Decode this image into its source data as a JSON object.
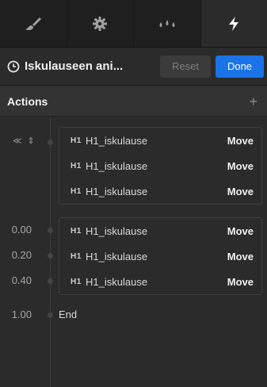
{
  "tabs": [
    {
      "icon": "brush-icon"
    },
    {
      "icon": "gear-icon"
    },
    {
      "icon": "droplets-icon"
    },
    {
      "icon": "lightning-icon",
      "active": true
    }
  ],
  "header": {
    "title": "Iskulauseen ani...",
    "reset_label": "Reset",
    "done_label": "Done"
  },
  "actions": {
    "title": "Actions",
    "add_label": "+"
  },
  "timeline": {
    "group1": {
      "rows": [
        {
          "icon": "H1",
          "target": "H1_iskulause",
          "action": "Move"
        },
        {
          "icon": "H1",
          "target": "H1_iskulause",
          "action": "Move"
        },
        {
          "icon": "H1",
          "target": "H1_iskulause",
          "action": "Move"
        }
      ]
    },
    "group2": {
      "rows": [
        {
          "time": "0.00",
          "icon": "H1",
          "target": "H1_iskulause",
          "action": "Move"
        },
        {
          "time": "0.20",
          "icon": "H1",
          "target": "H1_iskulause",
          "action": "Move"
        },
        {
          "time": "0.40",
          "icon": "H1",
          "target": "H1_iskulause",
          "action": "Move"
        }
      ]
    },
    "end": {
      "time": "1.00",
      "label": "End"
    }
  },
  "colors": {
    "accent": "#1b73e8",
    "background": "#2b2b2b"
  }
}
